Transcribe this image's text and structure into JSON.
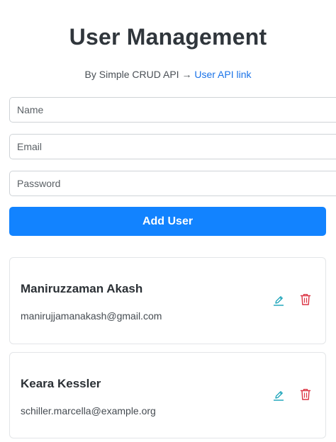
{
  "header": {
    "title": "User Management",
    "subtitle_prefix": "By Simple CRUD API →",
    "link_label": "User API link"
  },
  "form": {
    "name_placeholder": "Name",
    "email_placeholder": "Email",
    "password_placeholder": "Password",
    "submit_label": "Add User"
  },
  "users": [
    {
      "name": "Maniruzzaman Akash",
      "email": "manirujjamanakash@gmail.com"
    },
    {
      "name": "Keara Kessler",
      "email": "schiller.marcella@example.org"
    }
  ],
  "icons": {
    "edit": "pencil-icon",
    "delete": "trash-icon"
  },
  "colors": {
    "primary": "#1283ff",
    "link": "#1a73e8",
    "edit": "#17a2b8",
    "delete": "#dc3545"
  }
}
